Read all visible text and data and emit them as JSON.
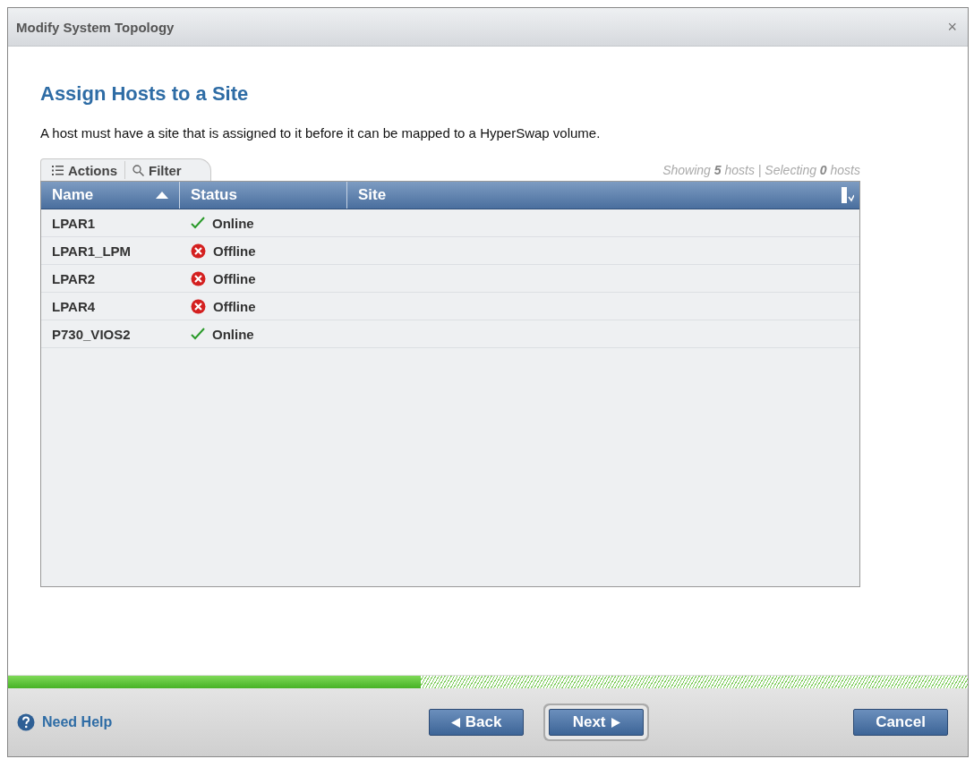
{
  "window": {
    "title": "Modify System Topology",
    "close": "×"
  },
  "heading": "Assign Hosts to a Site",
  "description": "A host must have a site that is assigned to it before it can be mapped to a HyperSwap volume.",
  "toolbar": {
    "tabs": [
      {
        "label": "Actions",
        "kind": "actions"
      },
      {
        "label": "Filter",
        "kind": "filter"
      }
    ],
    "summary": "Showing **5** hosts | Selecting **0** hosts"
  },
  "table": {
    "columns": [
      {
        "label": "Name",
        "sorted": true
      },
      {
        "label": "Status",
        "sorted": false
      },
      {
        "label": "Site",
        "sorted": false
      }
    ],
    "rows": [
      {
        "name": "LPAR1",
        "status": "Online",
        "kind": "online"
      },
      {
        "name": "LPAR1_LPM",
        "status": "Offline",
        "kind": "offline"
      },
      {
        "name": "LPAR2",
        "status": "Offline",
        "kind": "offline"
      },
      {
        "name": "LPAR4",
        "status": "Offline",
        "kind": "offline"
      },
      {
        "name": "P730_VIOS2",
        "status": "Online",
        "kind": "online"
      }
    ]
  },
  "progress": {
    "level": 0.43
  },
  "footer": {
    "help": "Need Help",
    "buttons": [
      {
        "label": "Back",
        "kind": "back",
        "focused": false
      },
      {
        "label": "Next",
        "kind": "next",
        "focused": true
      }
    ],
    "cancel": "Cancel"
  }
}
